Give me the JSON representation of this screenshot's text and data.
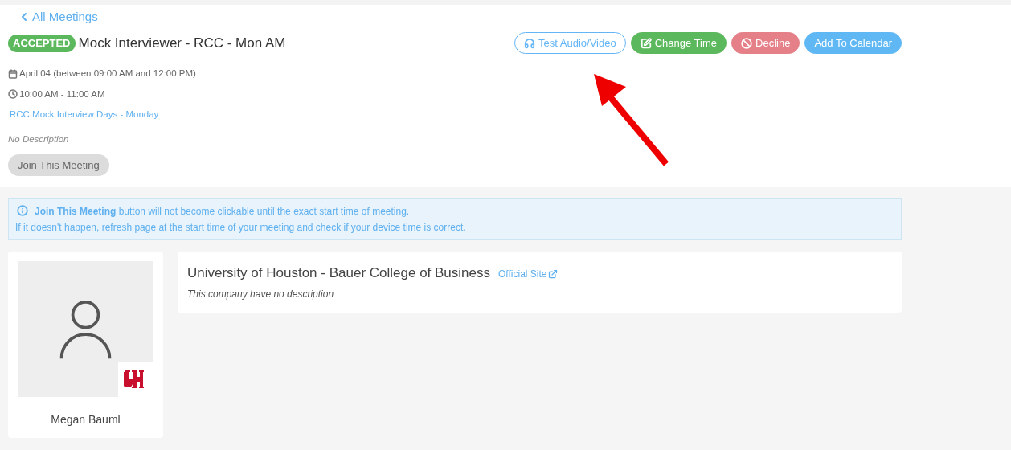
{
  "back_link": {
    "label": "All Meetings"
  },
  "meeting": {
    "status": "ACCEPTED",
    "title": "Mock Interviewer - RCC - Mon AM",
    "date": "April 04 (between 09:00 AM and 12:00 PM)",
    "time": "10:00 AM - 11:00 AM",
    "event_link": "RCC Mock Interview Days - Monday",
    "description": "No Description"
  },
  "actions": [
    {
      "label": "Test Audio/Video",
      "kind": "outline"
    },
    {
      "label": "Change Time",
      "kind": "success"
    },
    {
      "label": "Decline",
      "kind": "danger"
    },
    {
      "label": "Add To Calendar",
      "kind": "info"
    }
  ],
  "join_button": {
    "label": "Join This Meeting",
    "disabled": true
  },
  "notice": {
    "lines": [
      "**Join This Meeting** button will not become clickable until the exact start time of meeting.",
      "If it doesn't happen, refresh page at the start time of your meeting and check if your device time is correct."
    ]
  },
  "person": {
    "name": "Megan Bauml"
  },
  "company": {
    "name": "University of Houston - Bauer College of Business",
    "site_link": "Official Site",
    "description": "This company have no description"
  }
}
